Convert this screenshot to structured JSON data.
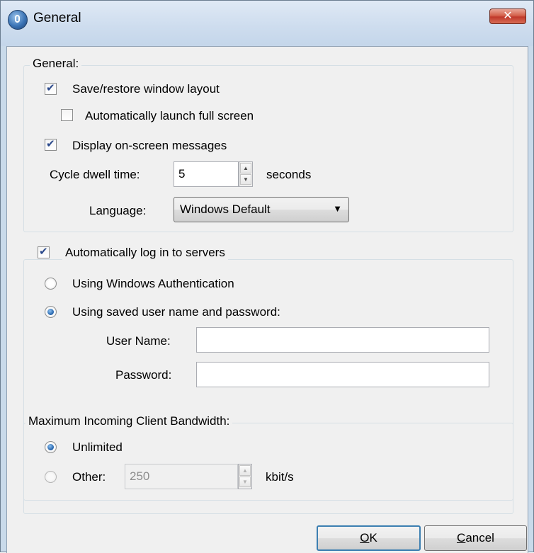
{
  "window": {
    "title": "General",
    "close_glyph": "✕"
  },
  "general_group": {
    "legend": "General:",
    "save_layout": {
      "label": "Save/restore window layout",
      "checked": true
    },
    "auto_fullscreen": {
      "label": "Automatically launch full screen",
      "checked": false
    },
    "display_messages": {
      "label": "Display on-screen messages",
      "checked": true
    },
    "cycle_dwell": {
      "label": "Cycle dwell time:",
      "value": "5",
      "unit": "seconds"
    },
    "language": {
      "label": "Language:",
      "value": "Windows Default"
    }
  },
  "login_group": {
    "legend_checkbox": {
      "label": "Automatically log in to servers",
      "checked": true
    },
    "windows_auth": {
      "label": "Using Windows Authentication",
      "selected": false
    },
    "saved_credentials": {
      "label": "Using saved user name and password:",
      "selected": true
    },
    "user_name": {
      "label": "User Name:",
      "value": ""
    },
    "password": {
      "label": "Password:",
      "value": ""
    }
  },
  "bandwidth_group": {
    "legend": "Maximum Incoming Client Bandwidth:",
    "unlimited": {
      "label": "Unlimited",
      "selected": true
    },
    "other": {
      "label": "Other:",
      "selected": false,
      "value": "250",
      "unit": "kbit/s"
    }
  },
  "buttons": {
    "ok": {
      "prefix": "",
      "accel": "O",
      "rest": "K"
    },
    "cancel": {
      "prefix": "",
      "accel": "C",
      "rest": "ancel"
    }
  },
  "icons": {
    "app": "app-icon",
    "close": "close-icon",
    "spin_up": "▲",
    "spin_down": "▼",
    "dropdown": "▼"
  }
}
